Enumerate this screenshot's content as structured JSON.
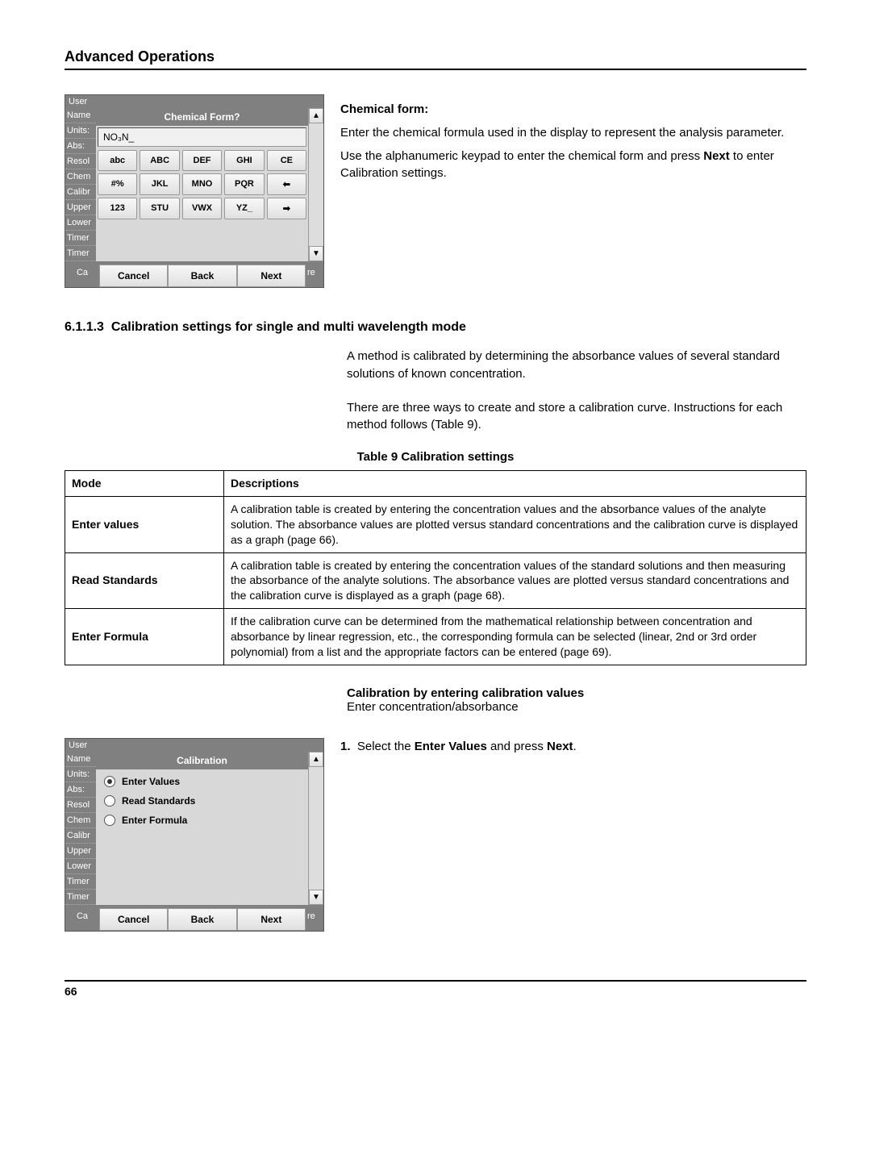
{
  "header": {
    "title": "Advanced Operations"
  },
  "widget1": {
    "top_label": "User",
    "title": "Chemical Form?",
    "side": [
      "Name",
      "Units:",
      "Abs:",
      "Resol",
      "Chem",
      "Calibr",
      "Upper",
      "Lower",
      "Timer",
      "Timer"
    ],
    "input_value": "NO₃N_",
    "keys": [
      [
        "abc",
        "ABC",
        "DEF",
        "GHI",
        "CE"
      ],
      [
        "#%",
        "JKL",
        "MNO",
        "PQR",
        "⬅"
      ],
      [
        "123",
        "STU",
        "VWX",
        "YZ_",
        "➡"
      ]
    ],
    "nav": {
      "cancel": "Cancel",
      "back": "Back",
      "next": "Next"
    },
    "ca": "Ca",
    "re": "re",
    "scroll_up": "▲",
    "scroll_down": "▼"
  },
  "chem_form": {
    "heading": "Chemical form:",
    "p1": "Enter the chemical formula used in the display to represent the analysis parameter.",
    "p2a": "Use the alphanumeric keypad to enter the chemical form and press ",
    "p2b": "Next",
    "p2c": " to enter Calibration settings."
  },
  "section": {
    "num": "6.1.1.3",
    "title": "Calibration settings for single and multi wavelength mode",
    "p1": "A method is calibrated by determining the absorbance values of several standard solutions of known concentration.",
    "p2": "There are three ways to create and store a calibration curve. Instructions for each method follows (Table 9)."
  },
  "table": {
    "title": "Table 9  Calibration settings",
    "head_mode": "Mode",
    "head_desc": "Descriptions",
    "rows": [
      {
        "mode": "Enter values",
        "desc": "A calibration table is created by entering the concentration values and the absorbance values of the analyte solution. The absorbance values are plotted versus standard concentrations and the calibration curve is displayed as a graph (page 66)."
      },
      {
        "mode": "Read Standards",
        "desc": "A calibration table is created by entering the concentration values of the standard solutions and then measuring the absorbance of the analyte solutions. The absorbance values are plotted versus standard concentrations and the calibration curve is displayed as a graph (page 68)."
      },
      {
        "mode": "Enter Formula",
        "desc": "If the calibration curve can be determined from the mathematical relationship between concentration and absorbance by linear regression, etc., the corresponding formula can be selected (linear, 2nd or 3rd order polynomial) from a list and the appropriate factors can be entered (page 69)."
      }
    ]
  },
  "subhead": {
    "bold": "Calibration by entering calibration values",
    "line": "Enter concentration/absorbance"
  },
  "widget2": {
    "top_label": "User",
    "title": "Calibration",
    "side": [
      "Name",
      "Units:",
      "Abs:",
      "Resol",
      "Chem",
      "Calibr",
      "Upper",
      "Lower",
      "Timer",
      "Timer"
    ],
    "options": [
      "Enter Values",
      "Read Standards",
      "Enter Formula"
    ],
    "nav": {
      "cancel": "Cancel",
      "back": "Back",
      "next": "Next"
    },
    "ca": "Ca",
    "re": "re",
    "scroll_up": "▲",
    "scroll_down": "▼"
  },
  "step": {
    "num": "1.",
    "t1": "Select the ",
    "b1": "Enter Values",
    "t2": " and press ",
    "b2": "Next",
    "t3": "."
  },
  "footer": {
    "page": "66"
  }
}
